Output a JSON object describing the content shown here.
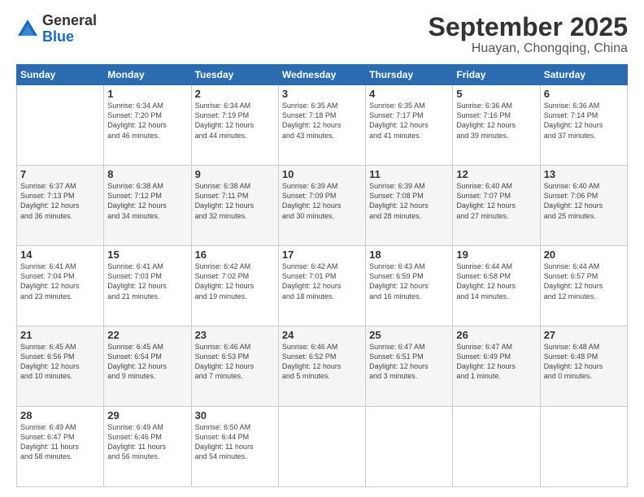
{
  "logo": {
    "general": "General",
    "blue": "Blue"
  },
  "header": {
    "month": "September 2025",
    "location": "Huayan, Chongqing, China"
  },
  "weekdays": [
    "Sunday",
    "Monday",
    "Tuesday",
    "Wednesday",
    "Thursday",
    "Friday",
    "Saturday"
  ],
  "weeks": [
    [
      {
        "day": "",
        "info": ""
      },
      {
        "day": "1",
        "info": "Sunrise: 6:34 AM\nSunset: 7:20 PM\nDaylight: 12 hours\nand 46 minutes."
      },
      {
        "day": "2",
        "info": "Sunrise: 6:34 AM\nSunset: 7:19 PM\nDaylight: 12 hours\nand 44 minutes."
      },
      {
        "day": "3",
        "info": "Sunrise: 6:35 AM\nSunset: 7:18 PM\nDaylight: 12 hours\nand 43 minutes."
      },
      {
        "day": "4",
        "info": "Sunrise: 6:35 AM\nSunset: 7:17 PM\nDaylight: 12 hours\nand 41 minutes."
      },
      {
        "day": "5",
        "info": "Sunrise: 6:36 AM\nSunset: 7:16 PM\nDaylight: 12 hours\nand 39 minutes."
      },
      {
        "day": "6",
        "info": "Sunrise: 6:36 AM\nSunset: 7:14 PM\nDaylight: 12 hours\nand 37 minutes."
      }
    ],
    [
      {
        "day": "7",
        "info": "Sunrise: 6:37 AM\nSunset: 7:13 PM\nDaylight: 12 hours\nand 36 minutes."
      },
      {
        "day": "8",
        "info": "Sunrise: 6:38 AM\nSunset: 7:12 PM\nDaylight: 12 hours\nand 34 minutes."
      },
      {
        "day": "9",
        "info": "Sunrise: 6:38 AM\nSunset: 7:11 PM\nDaylight: 12 hours\nand 32 minutes."
      },
      {
        "day": "10",
        "info": "Sunrise: 6:39 AM\nSunset: 7:09 PM\nDaylight: 12 hours\nand 30 minutes."
      },
      {
        "day": "11",
        "info": "Sunrise: 6:39 AM\nSunset: 7:08 PM\nDaylight: 12 hours\nand 28 minutes."
      },
      {
        "day": "12",
        "info": "Sunrise: 6:40 AM\nSunset: 7:07 PM\nDaylight: 12 hours\nand 27 minutes."
      },
      {
        "day": "13",
        "info": "Sunrise: 6:40 AM\nSunset: 7:06 PM\nDaylight: 12 hours\nand 25 minutes."
      }
    ],
    [
      {
        "day": "14",
        "info": "Sunrise: 6:41 AM\nSunset: 7:04 PM\nDaylight: 12 hours\nand 23 minutes."
      },
      {
        "day": "15",
        "info": "Sunrise: 6:41 AM\nSunset: 7:03 PM\nDaylight: 12 hours\nand 21 minutes."
      },
      {
        "day": "16",
        "info": "Sunrise: 6:42 AM\nSunset: 7:02 PM\nDaylight: 12 hours\nand 19 minutes."
      },
      {
        "day": "17",
        "info": "Sunrise: 6:42 AM\nSunset: 7:01 PM\nDaylight: 12 hours\nand 18 minutes."
      },
      {
        "day": "18",
        "info": "Sunrise: 6:43 AM\nSunset: 6:59 PM\nDaylight: 12 hours\nand 16 minutes."
      },
      {
        "day": "19",
        "info": "Sunrise: 6:44 AM\nSunset: 6:58 PM\nDaylight: 12 hours\nand 14 minutes."
      },
      {
        "day": "20",
        "info": "Sunrise: 6:44 AM\nSunset: 6:57 PM\nDaylight: 12 hours\nand 12 minutes."
      }
    ],
    [
      {
        "day": "21",
        "info": "Sunrise: 6:45 AM\nSunset: 6:56 PM\nDaylight: 12 hours\nand 10 minutes."
      },
      {
        "day": "22",
        "info": "Sunrise: 6:45 AM\nSunset: 6:54 PM\nDaylight: 12 hours\nand 9 minutes."
      },
      {
        "day": "23",
        "info": "Sunrise: 6:46 AM\nSunset: 6:53 PM\nDaylight: 12 hours\nand 7 minutes."
      },
      {
        "day": "24",
        "info": "Sunrise: 6:46 AM\nSunset: 6:52 PM\nDaylight: 12 hours\nand 5 minutes."
      },
      {
        "day": "25",
        "info": "Sunrise: 6:47 AM\nSunset: 6:51 PM\nDaylight: 12 hours\nand 3 minutes."
      },
      {
        "day": "26",
        "info": "Sunrise: 6:47 AM\nSunset: 6:49 PM\nDaylight: 12 hours\nand 1 minute."
      },
      {
        "day": "27",
        "info": "Sunrise: 6:48 AM\nSunset: 6:48 PM\nDaylight: 12 hours\nand 0 minutes."
      }
    ],
    [
      {
        "day": "28",
        "info": "Sunrise: 6:49 AM\nSunset: 6:47 PM\nDaylight: 11 hours\nand 58 minutes."
      },
      {
        "day": "29",
        "info": "Sunrise: 6:49 AM\nSunset: 6:46 PM\nDaylight: 11 hours\nand 56 minutes."
      },
      {
        "day": "30",
        "info": "Sunrise: 6:50 AM\nSunset: 6:44 PM\nDaylight: 11 hours\nand 54 minutes."
      },
      {
        "day": "",
        "info": ""
      },
      {
        "day": "",
        "info": ""
      },
      {
        "day": "",
        "info": ""
      },
      {
        "day": "",
        "info": ""
      }
    ]
  ]
}
